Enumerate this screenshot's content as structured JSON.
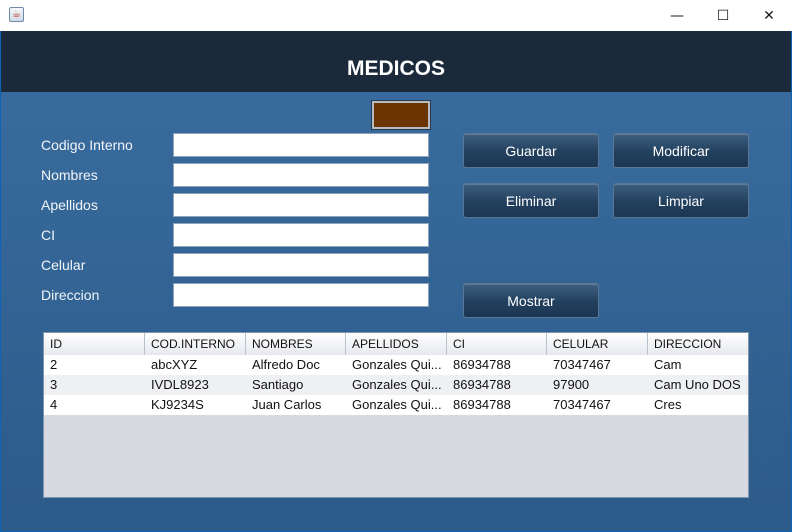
{
  "window": {
    "app_icon": "java-icon",
    "controls": {
      "minimize": "—",
      "maximize": "☐",
      "close": "✕"
    }
  },
  "header": {
    "title": "MEDICOS"
  },
  "color_swatch": {
    "color": "#6b3400"
  },
  "form": {
    "fields": [
      {
        "label": "Codigo Interno",
        "value": ""
      },
      {
        "label": "Nombres",
        "value": ""
      },
      {
        "label": "Apellidos",
        "value": ""
      },
      {
        "label": "CI",
        "value": ""
      },
      {
        "label": "Celular",
        "value": ""
      },
      {
        "label": "Direccion",
        "value": ""
      }
    ]
  },
  "buttons": {
    "guardar": "Guardar",
    "modificar": "Modificar",
    "eliminar": "Eliminar",
    "limpiar": "Limpiar",
    "mostrar": "Mostrar"
  },
  "table": {
    "columns": [
      "ID",
      "COD.INTERNO",
      "NOMBRES",
      "APELLIDOS",
      "CI",
      "CELULAR",
      "DIRECCION"
    ],
    "rows": [
      [
        "2",
        "abcXYZ",
        "Alfredo Doc",
        "Gonzales Qui...",
        "86934788",
        "70347467",
        "Cam"
      ],
      [
        "3",
        "IVDL8923",
        "Santiago",
        "Gonzales Qui...",
        "86934788",
        "97900",
        "Cam Uno DOS"
      ],
      [
        "4",
        "KJ9234S",
        "Juan Carlos",
        "Gonzales Qui...",
        "86934788",
        "70347467",
        "Cres"
      ]
    ]
  }
}
